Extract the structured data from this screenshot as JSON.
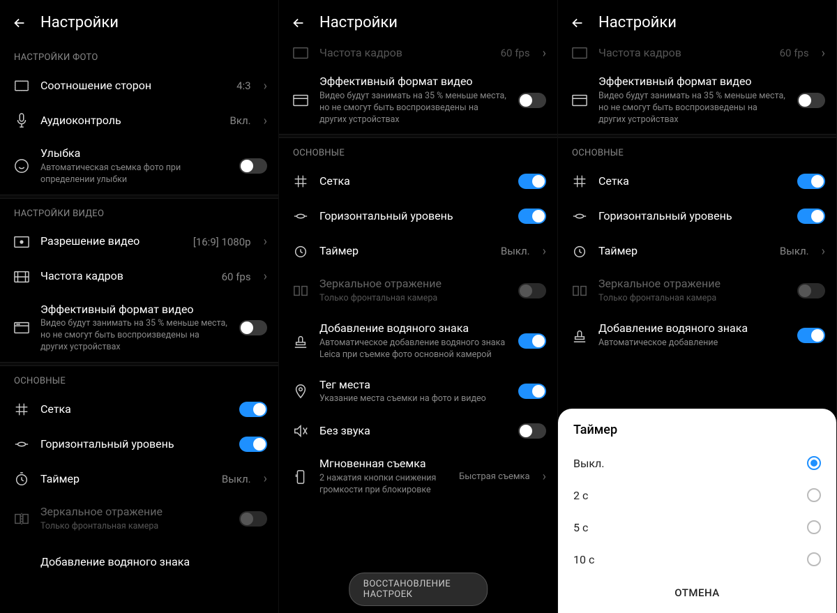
{
  "header": {
    "title": "Настройки"
  },
  "sections": {
    "photo_header": "НАСТРОЙКИ ФОТО",
    "video_header": "НАСТРОЙКИ ВИДЕО",
    "general_header": "ОСНОВНЫЕ"
  },
  "rows": {
    "aspect": {
      "title": "Соотношение сторон",
      "value": "4:3"
    },
    "audio": {
      "title": "Аудиоконтроль",
      "value": "Вкл."
    },
    "smile": {
      "title": "Улыбка",
      "sub": "Автоматическая съемка фото при определении улыбки"
    },
    "video_res": {
      "title": "Разрешение видео",
      "value": "[16:9] 1080p"
    },
    "fps": {
      "title": "Частота кадров",
      "value": "60 fps"
    },
    "eff_video": {
      "title": "Эффективный формат видео",
      "sub": "Видео будут занимать на 35 % меньше места, но не смогут быть воспроизведены на других устройствах"
    },
    "grid": {
      "title": "Сетка"
    },
    "level": {
      "title": "Горизонтальный уровень"
    },
    "timer": {
      "title": "Таймер",
      "value": "Выкл."
    },
    "mirror": {
      "title": "Зеркальное отражение",
      "sub": "Только фронтальная камера"
    },
    "watermark": {
      "title": "Добавление водяного знака",
      "sub": "Автоматическое добавление водяного знака Leica при съемке фото основной камерой"
    },
    "watermark_short": {
      "title": "Добавление водяного знака",
      "sub": "Автоматическое добавление"
    },
    "geotag": {
      "title": "Тег места",
      "sub": "Указание места съемки на фото и видео"
    },
    "mute": {
      "title": "Без звука"
    },
    "instant": {
      "title": "Мгновенная съемка",
      "sub": "2 нажатия кнопки снижения громкости при блокировке",
      "value": "Быстрая съемка"
    },
    "restore": "ВОССТАНОВЛЕНИЕ НАСТРОЕК"
  },
  "dialog": {
    "title": "Таймер",
    "options": [
      "Выкл.",
      "2 с",
      "5 с",
      "10 с"
    ],
    "cancel": "ОТМЕНА"
  }
}
